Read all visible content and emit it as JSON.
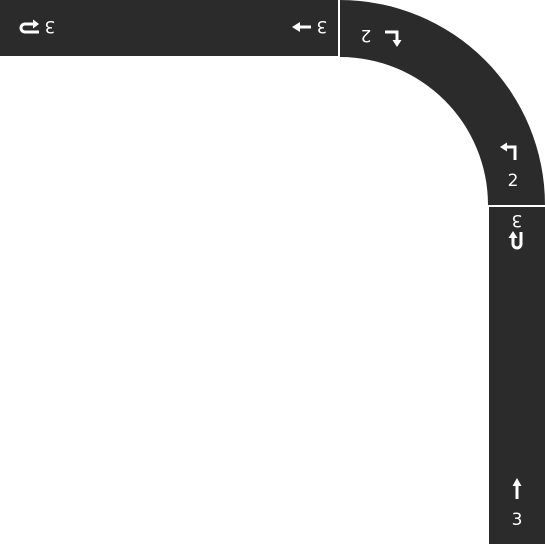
{
  "board": {
    "background_color": "#ffffff",
    "track_color": "#2b2b2b",
    "seam_color": "#ffffff",
    "marker_color": "#ffffff"
  },
  "tiles": [
    {
      "name": "straight-tile-top",
      "kind": "straight",
      "markers": [
        {
          "name": "tile-number-left",
          "number": "3",
          "icon": "u-turn-icon",
          "rotation_deg": 180
        },
        {
          "name": "tile-number-right",
          "number": "3",
          "icon": "straight-arrow-icon",
          "rotation_deg": 270
        }
      ]
    },
    {
      "name": "curve-tile-corner",
      "kind": "curve",
      "markers": [
        {
          "name": "tile-number-top",
          "number": "2",
          "icon": "turn-arrow-icon",
          "rotation_deg": 90
        },
        {
          "name": "tile-number-bottom",
          "number": "2",
          "icon": "turn-arrow-icon",
          "rotation_deg": 0
        }
      ]
    },
    {
      "name": "straight-tile-right",
      "kind": "straight",
      "markers": [
        {
          "name": "tile-number-top",
          "number": "3",
          "icon": "u-turn-icon",
          "rotation_deg": 180
        },
        {
          "name": "tile-number-bottom",
          "number": "3",
          "icon": "straight-arrow-icon",
          "rotation_deg": 0
        }
      ]
    }
  ]
}
